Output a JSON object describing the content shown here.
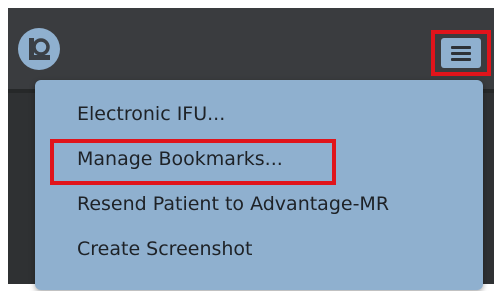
{
  "app": {
    "logo_icon": "camera-lens-icon",
    "menu_icon": "hamburger-menu-icon",
    "accent_color": "#8fb0cf",
    "highlight_color": "#e0141b"
  },
  "menu": {
    "items": [
      {
        "label": "Electronic IFU..."
      },
      {
        "label": "Manage Bookmarks..."
      },
      {
        "label": "Resend Patient to Advantage-MR"
      },
      {
        "label": "Create Screenshot"
      }
    ],
    "highlighted_index": 1
  }
}
